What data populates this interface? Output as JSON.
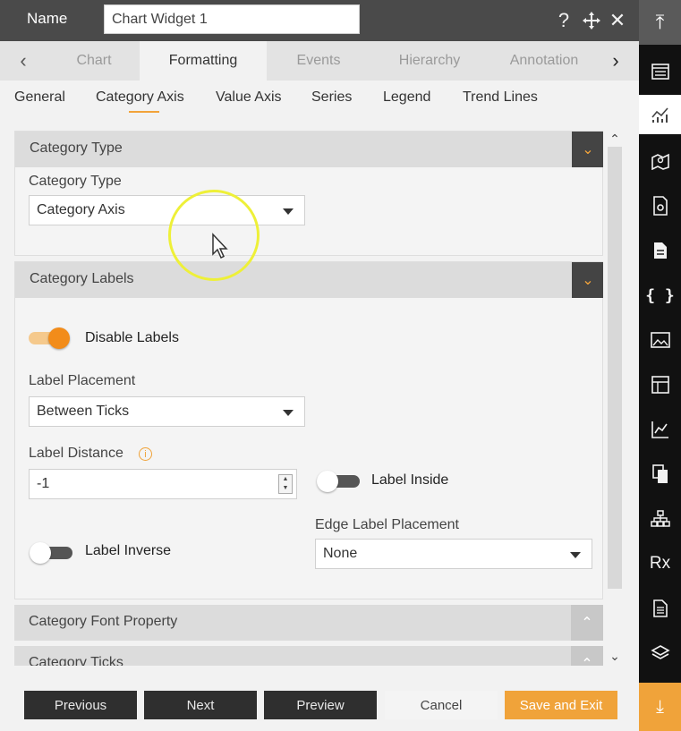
{
  "header": {
    "name_label": "Name",
    "name_value": "Chart Widget 1",
    "help_icon": "question-icon",
    "move_icon": "move-icon",
    "close_icon": "close-icon"
  },
  "tabs": {
    "items": [
      "Chart",
      "Formatting",
      "Events",
      "Hierarchy",
      "Annotation"
    ],
    "active": "Formatting"
  },
  "subtabs": {
    "items": [
      "General",
      "Category Axis",
      "Value Axis",
      "Series",
      "Legend",
      "Trend Lines"
    ],
    "active": "Category Axis"
  },
  "sections": {
    "category_type": {
      "title": "Category Type",
      "field_label": "Category Type",
      "value": "Category Axis"
    },
    "category_labels": {
      "title": "Category Labels",
      "disable_labels": {
        "label": "Disable Labels",
        "on": true
      },
      "label_placement": {
        "label": "Label Placement",
        "value": "Between Ticks"
      },
      "label_distance": {
        "label": "Label Distance",
        "value": "-1"
      },
      "label_inside": {
        "label": "Label Inside",
        "on": false
      },
      "label_inverse": {
        "label": "Label Inverse",
        "on": false
      },
      "edge_label_placement": {
        "label": "Edge Label Placement",
        "value": "None"
      }
    },
    "category_font_property": {
      "title": "Category Font Property"
    },
    "category_ticks": {
      "title": "Category Ticks"
    }
  },
  "footer": {
    "previous": "Previous",
    "next": "Next",
    "preview": "Preview",
    "cancel": "Cancel",
    "save_exit": "Save and Exit"
  },
  "rail": {
    "icons": [
      "collapse-top-icon",
      "widget-list-icon",
      "chart-icon",
      "map-icon",
      "document-settings-icon",
      "page-icon",
      "code-braces-icon",
      "image-icon",
      "table-icon",
      "line-chart-icon",
      "copy-icon",
      "hierarchy-icon",
      "rx-icon",
      "report-icon",
      "layers-icon",
      "download-icon"
    ],
    "rx_label": "Rx"
  },
  "colors": {
    "accent": "#f0a33a",
    "header_bg": "#4a4a4a",
    "dark_button": "#2f2f2f",
    "rail_bg": "#111111"
  }
}
